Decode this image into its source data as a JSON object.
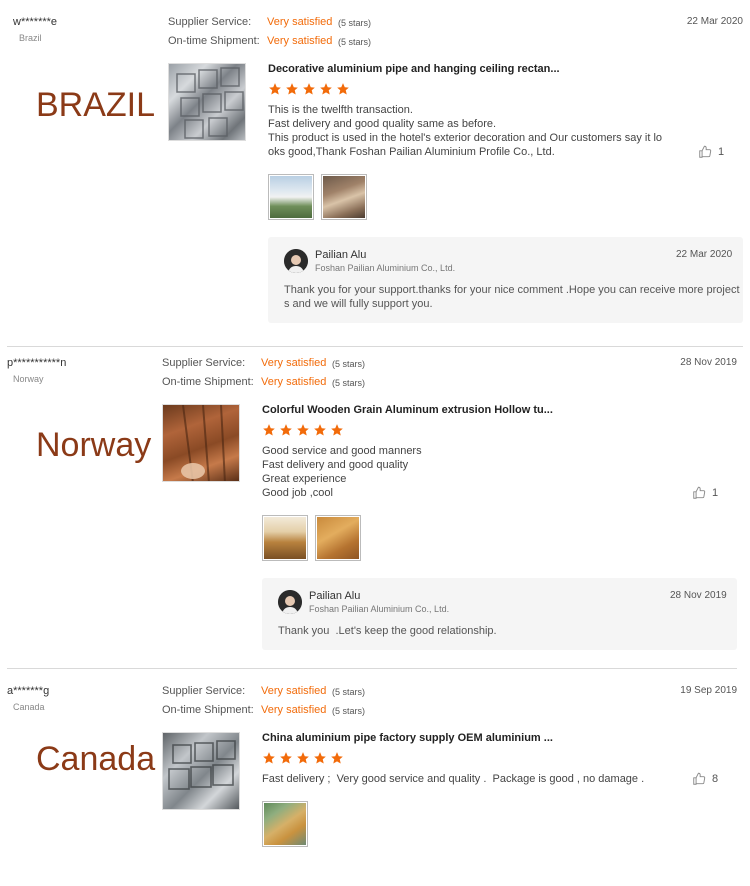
{
  "reviews": [
    {
      "buyer": "w*******e",
      "country": "Brazil",
      "overlay_label": "BRAZIL",
      "ratings": [
        {
          "label": "Supplier Service:",
          "value": "Very satisfied",
          "stars": "(5 stars)"
        },
        {
          "label": "On-time Shipment:",
          "value": "Very satisfied",
          "stars": "(5 stars)"
        }
      ],
      "date": "22 Mar 2020",
      "product_title": "Decorative aluminium pipe and hanging ceiling rectan...",
      "star_count": 5,
      "comment_lines": [
        "This is the twelfth transaction.",
        "Fast delivery and good quality same as before.",
        "This product is used in the hotel's exterior decoration and Our customers say it lo",
        "oks good,Thank Foshan Pailian Aluminium Profile Co., Ltd."
      ],
      "likes": "1",
      "reply": {
        "name": "Pailian Alu",
        "company": "Foshan Pailian Aluminium Co., Ltd.",
        "date": "22 Mar 2020",
        "lines": [
          "Thank you for your support.thanks for your nice comment .Hope you can receive more project",
          "s and we will fully support you."
        ]
      }
    },
    {
      "buyer": "p***********n",
      "country": "Norway",
      "overlay_label": "Norway",
      "ratings": [
        {
          "label": "Supplier Service:",
          "value": "Very satisfied",
          "stars": "(5 stars)"
        },
        {
          "label": "On-time Shipment:",
          "value": "Very satisfied",
          "stars": "(5 stars)"
        }
      ],
      "date": "28 Nov 2019",
      "product_title": "Colorful Wooden Grain Aluminum extrusion Hollow tu...",
      "star_count": 5,
      "comment_lines": [
        "Good service and good manners",
        "Fast delivery and good quality",
        "Great experience",
        "Good job ,cool"
      ],
      "likes": "1",
      "reply": {
        "name": "Pailian Alu",
        "company": "Foshan Pailian Aluminium Co., Ltd.",
        "date": "28 Nov 2019",
        "lines": [
          "Thank you  .Let's keep the good relationship."
        ]
      }
    },
    {
      "buyer": "a*******g",
      "country": "Canada",
      "overlay_label": "Canada",
      "ratings": [
        {
          "label": "Supplier Service:",
          "value": "Very satisfied",
          "stars": "(5 stars)"
        },
        {
          "label": "On-time Shipment:",
          "value": "Very satisfied",
          "stars": "(5 stars)"
        }
      ],
      "date": "19 Sep 2019",
      "product_title": "China aluminium pipe factory supply OEM aluminium ...",
      "star_count": 5,
      "comment_lines": [
        "Fast delivery ;  Very good service and quality .  Package is good , no damage ."
      ],
      "likes": "8"
    }
  ],
  "colors": {
    "accent": "#f26b0a",
    "overlay_text": "#8b3a17",
    "reply_bg": "#f5f5f5",
    "divider": "#d9d9d9"
  },
  "icons": {
    "like": "thumbs-up-icon",
    "star": "star-icon"
  }
}
